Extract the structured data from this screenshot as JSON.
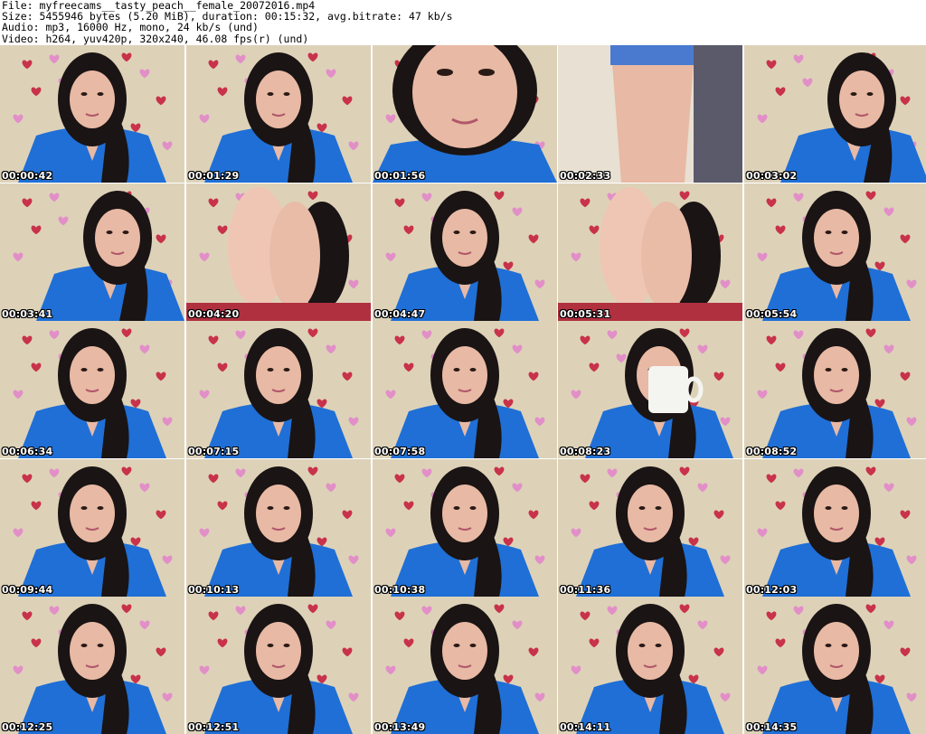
{
  "header": {
    "file": "File: myfreecams__tasty_peach__female_20072016.mp4",
    "size": "Size: 5455946 bytes (5.20 MiB), duration: 00:15:32, avg.bitrate: 47 kb/s",
    "audio": "Audio: mp3, 16000 Hz, mono, 24 kb/s (und)",
    "video": "Video: h264, yuv420p, 320x240, 46.08 fps(r) (und)"
  },
  "thumbnails": [
    {
      "time": "00:00:42",
      "scene": "face"
    },
    {
      "time": "00:01:29",
      "scene": "face"
    },
    {
      "time": "00:01:56",
      "scene": "closeup"
    },
    {
      "time": "00:02:33",
      "scene": "legs"
    },
    {
      "time": "00:03:02",
      "scene": "lean"
    },
    {
      "time": "00:03:41",
      "scene": "lean"
    },
    {
      "time": "00:04:20",
      "scene": "feet"
    },
    {
      "time": "00:04:47",
      "scene": "face"
    },
    {
      "time": "00:05:31",
      "scene": "feet"
    },
    {
      "time": "00:05:54",
      "scene": "face"
    },
    {
      "time": "00:06:34",
      "scene": "face"
    },
    {
      "time": "00:07:15",
      "scene": "face"
    },
    {
      "time": "00:07:58",
      "scene": "face"
    },
    {
      "time": "00:08:23",
      "scene": "mug"
    },
    {
      "time": "00:08:52",
      "scene": "face"
    },
    {
      "time": "00:09:44",
      "scene": "face"
    },
    {
      "time": "00:10:13",
      "scene": "face"
    },
    {
      "time": "00:10:38",
      "scene": "face"
    },
    {
      "time": "00:11:36",
      "scene": "face"
    },
    {
      "time": "00:12:03",
      "scene": "face"
    },
    {
      "time": "00:12:25",
      "scene": "face"
    },
    {
      "time": "00:12:51",
      "scene": "face"
    },
    {
      "time": "00:13:49",
      "scene": "face"
    },
    {
      "time": "00:14:11",
      "scene": "face"
    },
    {
      "time": "00:14:35",
      "scene": "face"
    }
  ],
  "colors": {
    "wall": "#ddd2b8",
    "top_blue": "#1f6fd6",
    "hair": "#1a1414",
    "skin": "#e8b9a4",
    "red_stickers": "#c8324a",
    "pink_stickers": "#e28fc8"
  }
}
